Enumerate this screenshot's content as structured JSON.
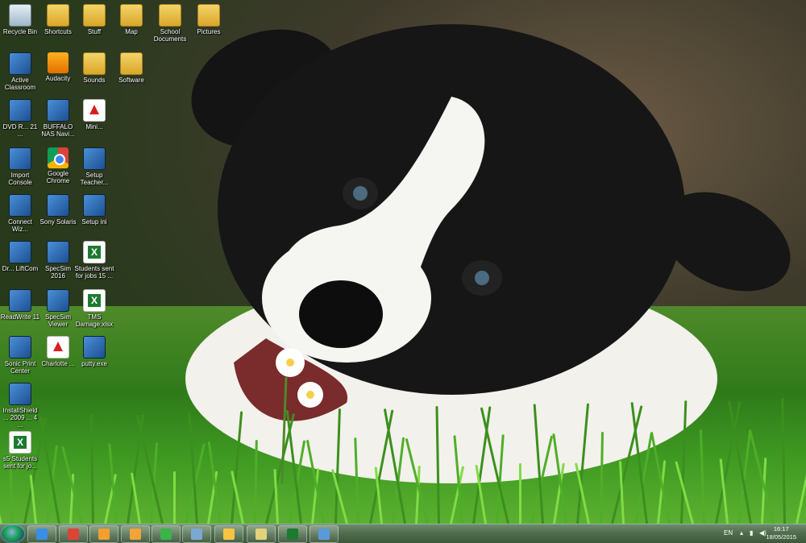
{
  "desktop": {
    "icons": [
      {
        "label": "Recycle Bin",
        "icon": "recycle-bin-icon"
      },
      {
        "label": "Shortcuts",
        "icon": "folder-icon"
      },
      {
        "label": "Stuff",
        "icon": "folder-icon"
      },
      {
        "label": "Map",
        "icon": "folder-icon"
      },
      {
        "label": "School Documents",
        "icon": "folder-icon"
      },
      {
        "label": "Pictures",
        "icon": "folder-icon"
      },
      {
        "label": "Active Classroom",
        "icon": "app-icon"
      },
      {
        "label": "Audacity",
        "icon": "audacity-icon"
      },
      {
        "label": "Sounds",
        "icon": "folder-icon"
      },
      {
        "label": "Software",
        "icon": "folder-icon"
      },
      {
        "label": "DVD R... 21 ...",
        "icon": "app-icon"
      },
      {
        "label": "BUFFALO NAS Navi...",
        "icon": "app-icon"
      },
      {
        "label": "Mini...",
        "icon": "pdf-icon"
      },
      {
        "label": "Import Console",
        "icon": "app-icon"
      },
      {
        "label": "Google Chrome",
        "icon": "chrome-icon"
      },
      {
        "label": "Setup Teacher...",
        "icon": "app-icon"
      },
      {
        "label": "Connect Wiz...",
        "icon": "app-icon"
      },
      {
        "label": "Sony Solaris",
        "icon": "app-icon"
      },
      {
        "label": "Setup ini",
        "icon": "app-icon"
      },
      {
        "label": "Dr... LiftCom",
        "icon": "app-icon"
      },
      {
        "label": "SpecSim 2016",
        "icon": "app-icon"
      },
      {
        "label": "Students sent for jobs 15 ...",
        "icon": "excel-icon"
      },
      {
        "label": "ReadWrite 11",
        "icon": "app-icon"
      },
      {
        "label": "SpecSim Viewer",
        "icon": "app-icon"
      },
      {
        "label": "TMS Damage.xlsx",
        "icon": "excel-icon"
      },
      {
        "label": "Sonic Print Center",
        "icon": "app-icon"
      },
      {
        "label": "Charlotte ...",
        "icon": "pdf-icon"
      },
      {
        "label": "putty.exe",
        "icon": "app-icon"
      },
      {
        "label": "InstallShield ... 2009 ... 4 ...",
        "icon": "app-icon"
      },
      {
        "label": "s5 Students sent for jo...",
        "icon": "excel-icon"
      }
    ]
  },
  "taskbar": {
    "start_label": "Start",
    "pinned": [
      {
        "name": "internet-explorer-icon",
        "color": "#3a8ee6"
      },
      {
        "name": "chrome-icon",
        "color": "#db4437"
      },
      {
        "name": "media-player-icon",
        "color": "#f0a030"
      },
      {
        "name": "outlook-icon",
        "color": "#f2a33a"
      },
      {
        "name": "green-app-icon",
        "color": "#3cb34a"
      },
      {
        "name": "scanner-app-icon",
        "color": "#7aa8d0"
      },
      {
        "name": "globe-app-icon",
        "color": "#f5c542"
      },
      {
        "name": "files-app-icon",
        "color": "#e3d27a"
      },
      {
        "name": "excel-icon",
        "color": "#1e7a30"
      },
      {
        "name": "remote-desktop-icon",
        "color": "#5a9ad8"
      }
    ],
    "tray": {
      "language": "EN",
      "time": "16:17",
      "date": "18/05/2015"
    }
  }
}
